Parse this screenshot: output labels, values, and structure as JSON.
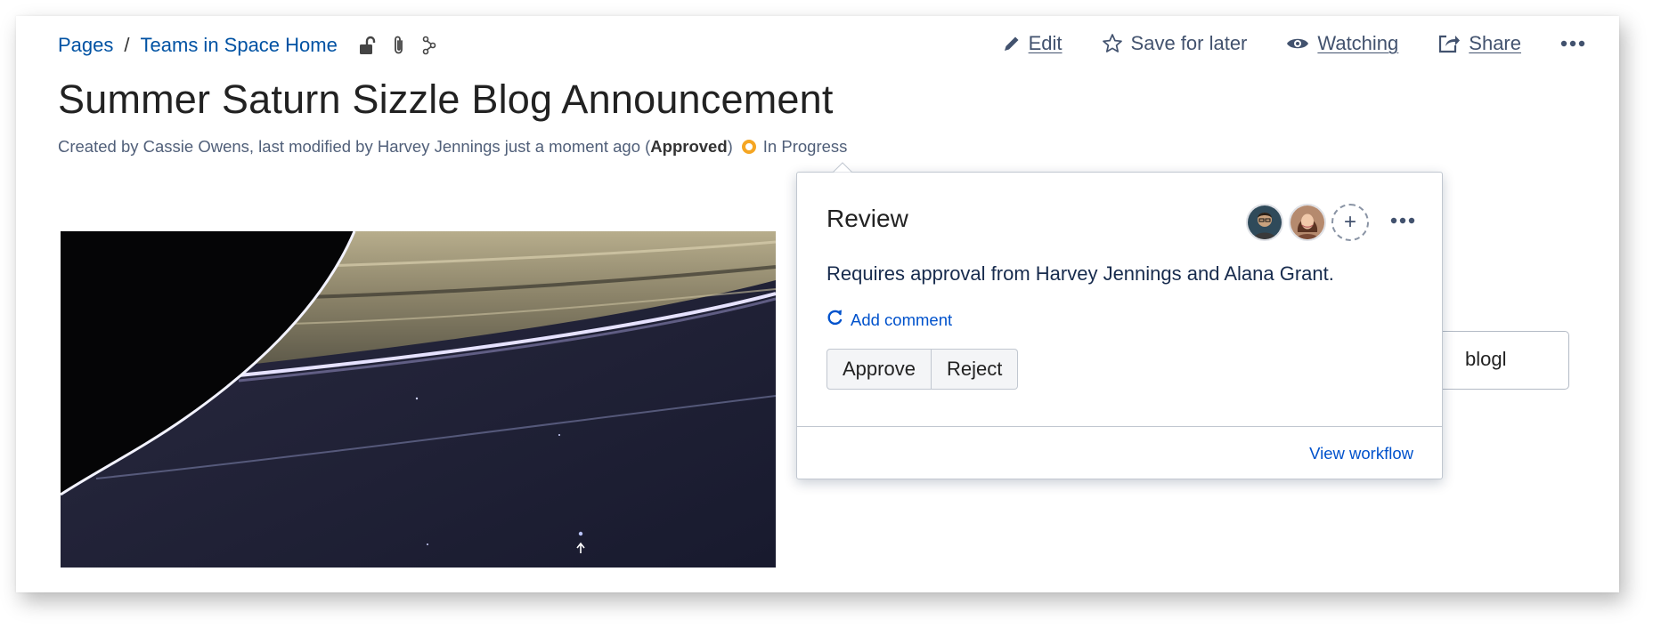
{
  "breadcrumb": {
    "items": [
      "Pages",
      "Teams in Space Home"
    ],
    "separator": "/",
    "icons": [
      "unlock-icon",
      "attachment-icon",
      "page-tree-icon"
    ]
  },
  "toolbar": {
    "edit_label": "Edit",
    "save_for_later_label": "Save for later",
    "watching_label": "Watching",
    "share_label": "Share",
    "more_icon": "more-horizontal-icon"
  },
  "page": {
    "title": "Summer Saturn Sizzle Blog Announcement",
    "byline_prefix": "Created by Cassie Owens, last modified by Harvey Jennings just a moment ago (",
    "byline_status": "Approved",
    "byline_suffix": ")",
    "workflow_status": "In Progress",
    "status_color": "#f5a623"
  },
  "background_field": {
    "visible_text": "blogl"
  },
  "review_popup": {
    "title": "Review",
    "description": "Requires approval from Harvey Jennings and Alana Grant.",
    "add_comment_label": "Add comment",
    "approve_label": "Approve",
    "reject_label": "Reject",
    "view_workflow_label": "View workflow",
    "add_reviewer_symbol": "+"
  },
  "colors": {
    "link": "#0052a3",
    "text": "#172b4d",
    "accent": "#0052cc"
  }
}
